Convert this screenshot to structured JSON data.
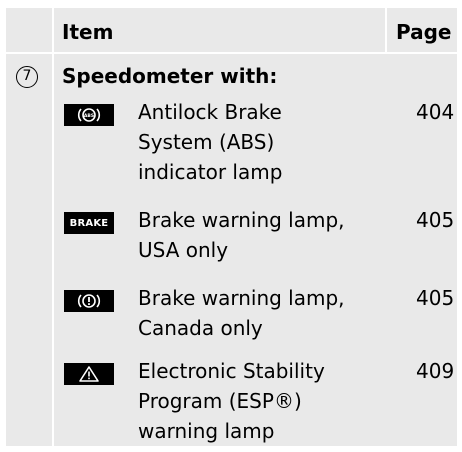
{
  "header": {
    "item": "Item",
    "page": "Page"
  },
  "section": {
    "number": "7",
    "title": "Speedometer with:"
  },
  "rows": [
    {
      "icon": "abs-warning-icon",
      "lines": [
        "Antilock Brake",
        "System (ABS)",
        "indicator lamp"
      ],
      "page": "404"
    },
    {
      "icon": "brake-text-icon",
      "icon_text": "BRAKE",
      "lines": [
        "Brake warning lamp,",
        "USA only"
      ],
      "page": "405"
    },
    {
      "icon": "brake-circle-exclamation-icon",
      "lines": [
        "Brake warning lamp,",
        "Canada only"
      ],
      "page": "405"
    },
    {
      "icon": "warning-triangle-icon",
      "lines": [
        "Electronic Stability",
        "Program (ESP®)",
        "warning lamp"
      ],
      "page": "409"
    }
  ],
  "colors": {
    "panel": "#e9e9e9",
    "icon_bg": "#000000",
    "text": "#000000"
  }
}
